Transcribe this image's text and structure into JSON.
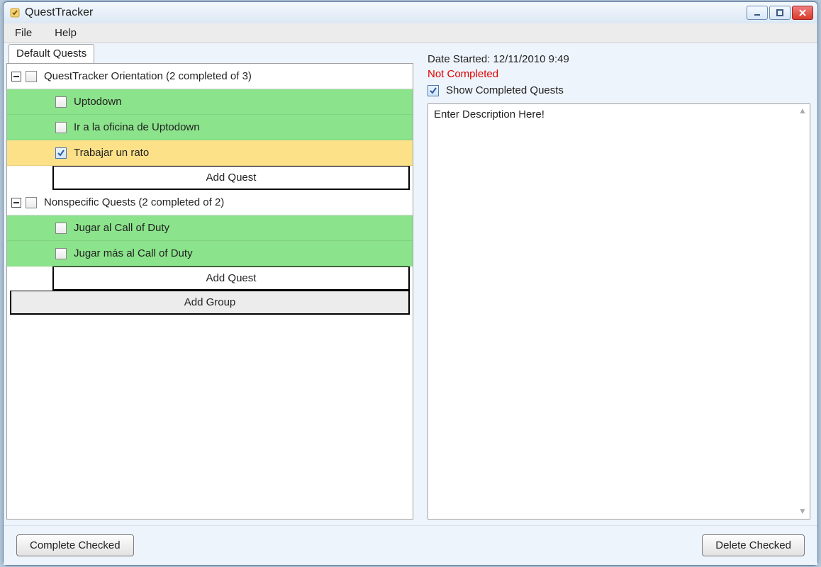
{
  "window": {
    "title": "QuestTracker"
  },
  "menu": {
    "file": "File",
    "help": "Help"
  },
  "tabs": {
    "default": "Default Quests"
  },
  "groups": [
    {
      "label": "QuestTracker Orientation (2 completed of 3)",
      "quests": [
        {
          "label": "Uptodown",
          "color": "green",
          "checked": false
        },
        {
          "label": "Ir a la oficina de Uptodown",
          "color": "green",
          "checked": false
        },
        {
          "label": "Trabajar un rato",
          "color": "yellow",
          "checked": true
        }
      ],
      "add_label": "Add Quest"
    },
    {
      "label": "Nonspecific Quests (2 completed of 2)",
      "quests": [
        {
          "label": "Jugar al Call of Duty",
          "color": "green",
          "checked": false
        },
        {
          "label": "Jugar más al Call of Duty",
          "color": "green",
          "checked": false
        }
      ],
      "add_label": "Add Quest"
    }
  ],
  "add_group_label": "Add Group",
  "details": {
    "date_line": "Date Started: 12/11/2010 9:49",
    "status": "Not Completed",
    "show_completed_label": "Show Completed Quests",
    "description_placeholder": "Enter Description Here!"
  },
  "buttons": {
    "complete": "Complete Checked",
    "delete": "Delete Checked"
  }
}
